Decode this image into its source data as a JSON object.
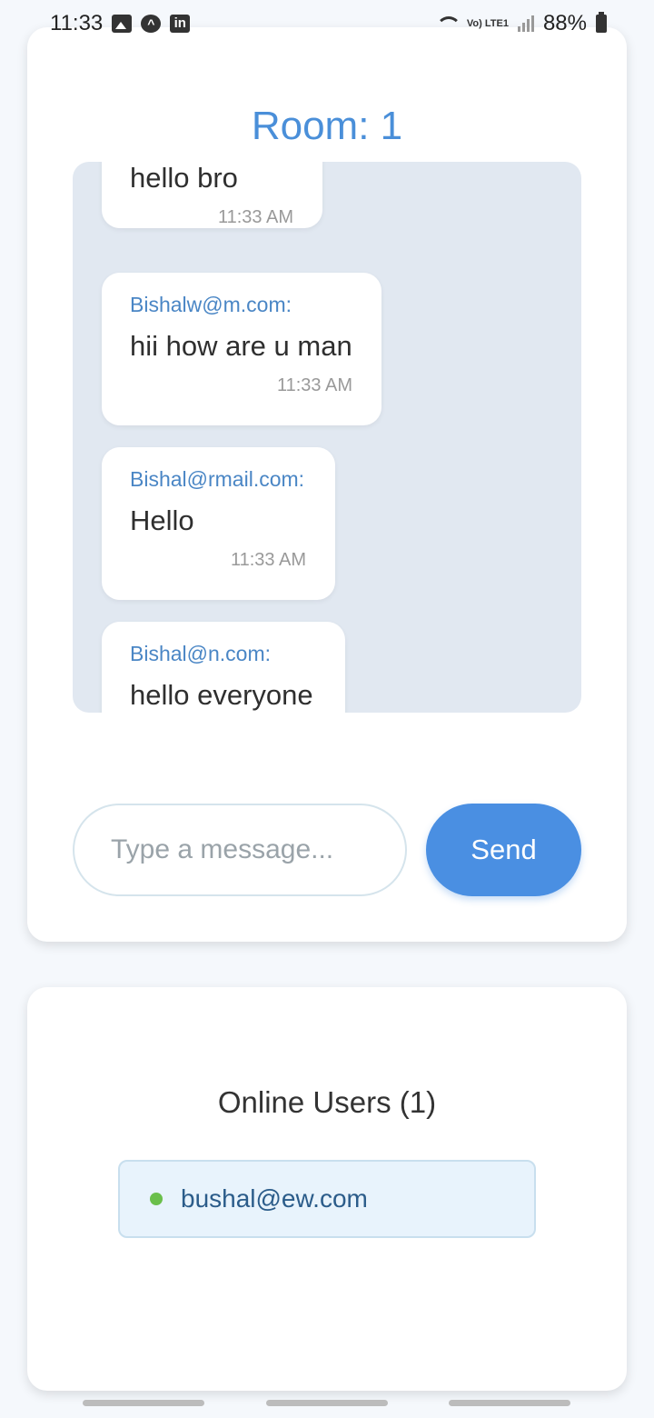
{
  "status_bar": {
    "time": "11:33",
    "battery": "88%",
    "network_label": "Vo) LTE1",
    "icons": [
      "gallery-icon",
      "app-icon",
      "linkedin-icon",
      "wifi-icon",
      "signal-icon",
      "battery-icon"
    ]
  },
  "chat": {
    "room_title": "Room: 1",
    "messages": [
      {
        "sender": "",
        "text": "hello bro",
        "time": "11:33 AM"
      },
      {
        "sender": "Bishalw@m.com:",
        "text": "hii how are u man",
        "time": "11:33 AM"
      },
      {
        "sender": "Bishal@rmail.com:",
        "text": "Hello",
        "time": "11:33 AM"
      },
      {
        "sender": "Bishal@n.com:",
        "text": "hello everyone",
        "time": ""
      }
    ],
    "input_placeholder": "Type a message...",
    "input_value": "",
    "send_label": "Send"
  },
  "users": {
    "title": "Online Users (1)",
    "list": [
      {
        "name": "bushal@ew.com",
        "status": "online"
      }
    ]
  },
  "colors": {
    "accent": "#4a8fe2",
    "room_title": "#4a8fd9",
    "sender": "#4a86c5",
    "online": "#6abf4b"
  }
}
